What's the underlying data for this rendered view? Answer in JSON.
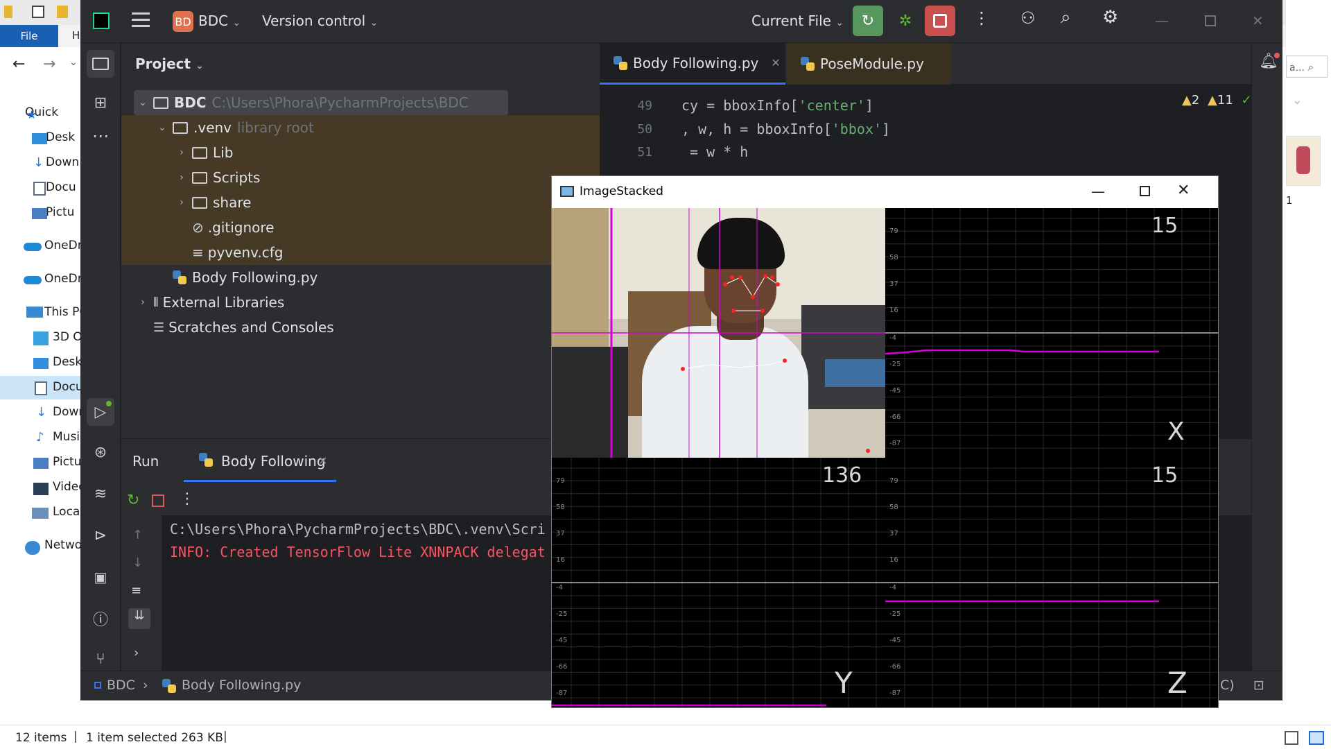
{
  "explorer": {
    "file_tab": "File",
    "h_tab": "H",
    "nav_items": [
      "Quick",
      "Desk",
      "Down",
      "Docu",
      "Pictu",
      "OneDr",
      "OneDr",
      "This PC",
      "3D O",
      "Desk",
      "Docu",
      "Down",
      "Musi",
      "Pictu",
      "Video",
      "Local",
      "Netwo"
    ],
    "status_items": "12 items",
    "status_selected": "1 item selected  263 KB",
    "right_search_hint": "a...",
    "right_number": "1"
  },
  "ide": {
    "project_badge": "BD",
    "project_name": "BDC",
    "version_control": "Version control",
    "run_config": "Current File",
    "project_panel_title": "Project",
    "tree": [
      {
        "name": "BDC",
        "hint": "C:\\Users\\Phora\\PycharmProjects\\BDC"
      },
      {
        "name": ".venv",
        "hint": "library root"
      },
      {
        "name": "Lib",
        "hint": ""
      },
      {
        "name": "Scripts",
        "hint": ""
      },
      {
        "name": "share",
        "hint": ""
      },
      {
        "name": ".gitignore",
        "hint": ""
      },
      {
        "name": "pyvenv.cfg",
        "hint": ""
      },
      {
        "name": "Body Following.py",
        "hint": ""
      },
      {
        "name": "External Libraries",
        "hint": ""
      },
      {
        "name": "Scratches and Consoles",
        "hint": ""
      }
    ],
    "tabs": [
      "Body Following.py",
      "PoseModule.py"
    ],
    "line_numbers": [
      "49",
      "50",
      "51"
    ],
    "code_lines": {
      "l49_a": "cy = bboxInfo[",
      "l49_s": "'center'",
      "l49_b": "]",
      "l50_a": ", w, h = bboxInfo[",
      "l50_s": "'bbox'",
      "l50_b": "]",
      "l51": " = w * h"
    },
    "inspections": {
      "warn_a": "2",
      "warn_b": "11",
      "ok": "7"
    },
    "run": {
      "title": "Run",
      "tab": "Body Following",
      "console_path": "C:\\Users\\Phora\\PycharmProjects\\BDC\\.venv\\Scri",
      "console_info": "INFO: Created TensorFlow Lite XNNPACK delegat"
    },
    "status": {
      "crumb_project": "BDC",
      "crumb_file": "Body Following.py",
      "right_text": "C)"
    }
  },
  "cvwindow": {
    "title": "ImageStacked",
    "plot_labels": {
      "top_right": "15",
      "mid_left": "136",
      "mid_right": "15",
      "x": "X",
      "y": "Y",
      "z": "Z"
    },
    "y_ticks_upper": [
      "79",
      "58",
      "37",
      "16"
    ],
    "y_ticks_lower": [
      "-4",
      "-25",
      "-45",
      "-66",
      "-87"
    ]
  },
  "colors": {
    "magenta": "#d800d8",
    "run_green": "#5fb832",
    "stop_red": "#db5c5c",
    "ide_bg": "#1e1f22",
    "panel_bg": "#2b2d30"
  }
}
